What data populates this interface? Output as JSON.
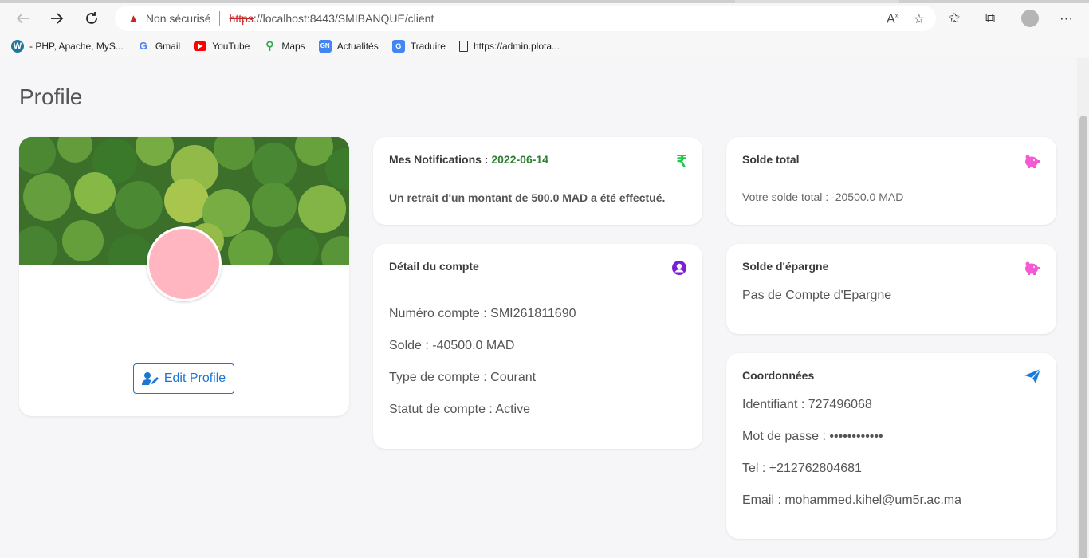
{
  "browser": {
    "security_label": "Non sécurisé",
    "url_scheme": "https",
    "url_rest": "://localhost:8443/SMIBANQUE/client",
    "bookmarks": [
      {
        "label": "- PHP, Apache, MyS...",
        "icon": "wordpress-icon"
      },
      {
        "label": "Gmail",
        "icon": "google-icon"
      },
      {
        "label": "YouTube",
        "icon": "youtube-icon"
      },
      {
        "label": "Maps",
        "icon": "maps-pin-icon"
      },
      {
        "label": "Actualités",
        "icon": "news-icon"
      },
      {
        "label": "Traduire",
        "icon": "translate-icon"
      },
      {
        "label": "https://admin.plota...",
        "icon": "page-icon"
      }
    ]
  },
  "page": {
    "title": "Profile"
  },
  "profile": {
    "edit_label": "Edit Profile"
  },
  "notifications": {
    "title": "Mes Notifications : ",
    "date": "2022-06-14",
    "message": "Un retrait d'un montant de 500.0 MAD a été effectué."
  },
  "account": {
    "title": "Détail du compte",
    "numero": "Numéro compte : SMI261811690",
    "solde": "Solde : -40500.0 MAD",
    "type": "Type de compte : Courant",
    "statut": "Statut de compte : Active"
  },
  "solde_total": {
    "title": "Solde total",
    "text": "Votre solde total : -20500.0 MAD"
  },
  "epargne": {
    "title": "Solde d'épargne",
    "text": "Pas de Compte d'Epargne"
  },
  "coordonnees": {
    "title": "Coordonnées",
    "identifiant": "Identifiant : 727496068",
    "mot_de_passe": "Mot de passe : ••••••••••••",
    "tel": "Tel : +212762804681",
    "email": "Email : mohammed.kihel@um5r.ac.ma"
  },
  "colors": {
    "accent_blue": "#1976d2",
    "date_green": "#2e7d32",
    "rupee_green": "#1ec94c",
    "piggy_pink": "#f45ad3",
    "account_purple": "#7b1fd6",
    "send_blue": "#1e7ad8",
    "avatar_pink": "#ffb6c1"
  }
}
